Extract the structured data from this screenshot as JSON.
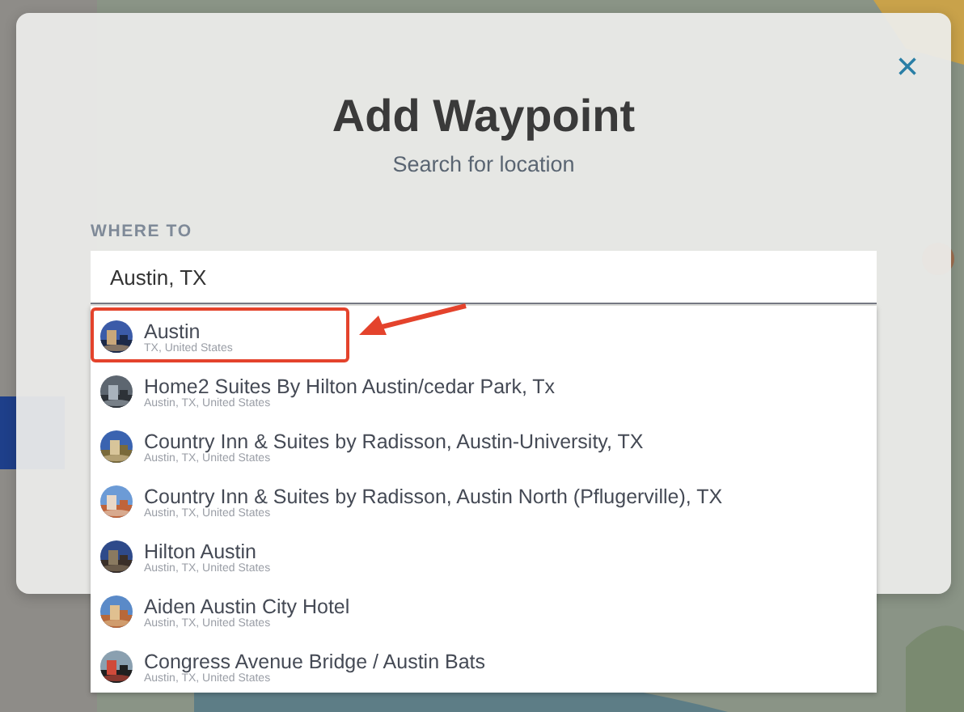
{
  "dialog": {
    "title": "Add Waypoint",
    "subtitle": "Search for location",
    "close": "×"
  },
  "field": {
    "label": "WHERE TO",
    "value": "Austin, TX"
  },
  "suggestions": [
    {
      "name": "Austin",
      "place": "TX, United States",
      "highlighted": true
    },
    {
      "name": "Home2 Suites By Hilton Austin/cedar Park, Tx",
      "place": "Austin, TX, United States",
      "highlighted": false
    },
    {
      "name": "Country Inn & Suites by Radisson, Austin-University, TX",
      "place": "Austin, TX, United States",
      "highlighted": false
    },
    {
      "name": "Country Inn & Suites by Radisson, Austin North (Pflugerville), TX",
      "place": "Austin, TX, United States",
      "highlighted": false
    },
    {
      "name": "Hilton Austin",
      "place": "Austin, TX, United States",
      "highlighted": false
    },
    {
      "name": "Aiden Austin City Hotel",
      "place": "Austin, TX, United States",
      "highlighted": false
    },
    {
      "name": "Congress Avenue Bridge / Austin Bats",
      "place": "Austin, TX, United States",
      "highlighted": false
    }
  ]
}
